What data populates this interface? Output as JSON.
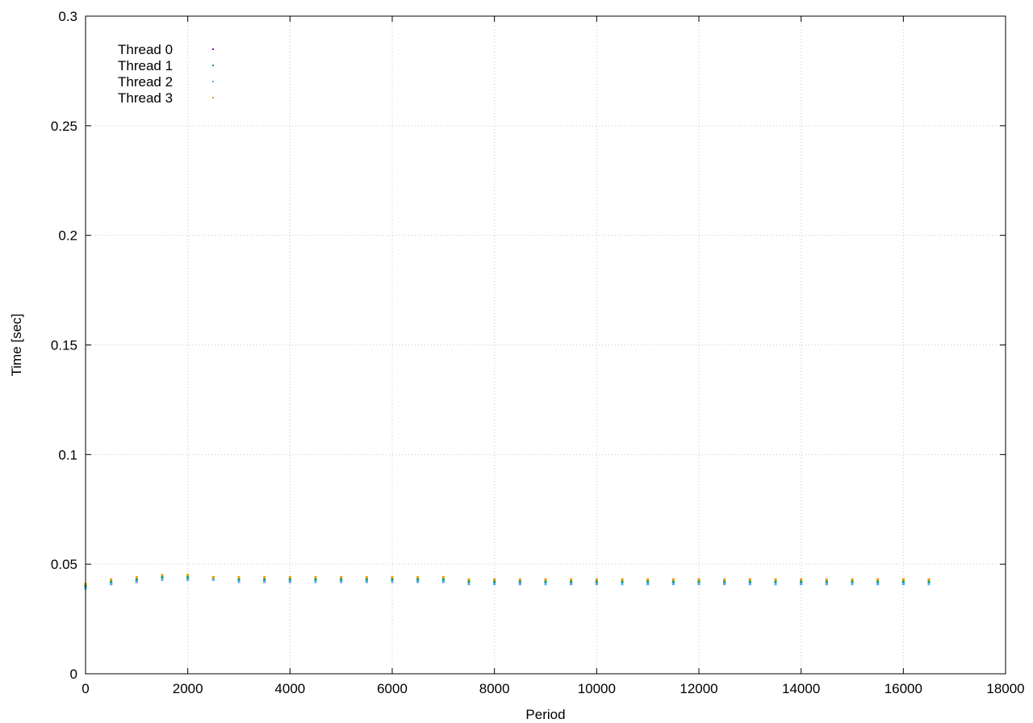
{
  "chart_data": {
    "type": "scatter",
    "title": "",
    "xlabel": "Period",
    "ylabel": "Time [sec]",
    "xlim": [
      0,
      18000
    ],
    "ylim": [
      0,
      0.3
    ],
    "xticks": [
      "0",
      "2000",
      "4000",
      "6000",
      "8000",
      "10000",
      "12000",
      "14000",
      "16000",
      "18000"
    ],
    "yticks": [
      "0",
      "0.05",
      "0.1",
      "0.15",
      "0.2",
      "0.25",
      "0.3"
    ],
    "grid": true,
    "legend_position": "top-left",
    "series": [
      {
        "name": "Thread 0",
        "color": "#9400d3",
        "x": [
          0,
          500,
          1000,
          1500,
          2000,
          2500,
          3000,
          3500,
          4000,
          4500,
          5000,
          5500,
          6000,
          6500,
          7000,
          7500,
          8000,
          8500,
          9000,
          9500,
          10000,
          10500,
          11000,
          11500,
          12000,
          12500,
          13000,
          13500,
          14000,
          14500,
          15000,
          15500,
          16000,
          16500
        ],
        "y": [
          0.039,
          0.041,
          0.042,
          0.043,
          0.043,
          0.043,
          0.042,
          0.042,
          0.042,
          0.042,
          0.042,
          0.042,
          0.042,
          0.042,
          0.042,
          0.041,
          0.041,
          0.041,
          0.041,
          0.041,
          0.041,
          0.041,
          0.041,
          0.041,
          0.041,
          0.041,
          0.041,
          0.041,
          0.041,
          0.041,
          0.041,
          0.041,
          0.041,
          0.041
        ]
      },
      {
        "name": "Thread 1",
        "color": "#009e73",
        "x": [
          0,
          500,
          1000,
          1500,
          2000,
          2500,
          3000,
          3500,
          4000,
          4500,
          5000,
          5500,
          6000,
          6500,
          7000,
          7500,
          8000,
          8500,
          9000,
          9500,
          10000,
          10500,
          11000,
          11500,
          12000,
          12500,
          13000,
          13500,
          14000,
          14500,
          15000,
          15500,
          16000,
          16500
        ],
        "y": [
          0.04,
          0.042,
          0.043,
          0.044,
          0.044,
          0.044,
          0.043,
          0.043,
          0.043,
          0.043,
          0.043,
          0.043,
          0.043,
          0.043,
          0.043,
          0.042,
          0.042,
          0.042,
          0.042,
          0.042,
          0.042,
          0.042,
          0.042,
          0.042,
          0.042,
          0.042,
          0.042,
          0.042,
          0.042,
          0.042,
          0.042,
          0.042,
          0.042,
          0.042
        ]
      },
      {
        "name": "Thread 2",
        "color": "#56b4e9",
        "x": [
          0,
          500,
          1000,
          1500,
          2000,
          2500,
          3000,
          3500,
          4000,
          4500,
          5000,
          5500,
          6000,
          6500,
          7000,
          7500,
          8000,
          8500,
          9000,
          9500,
          10000,
          10500,
          11000,
          11500,
          12000,
          12500,
          13000,
          13500,
          14000,
          14500,
          15000,
          15500,
          16000,
          16500
        ],
        "y": [
          0.039,
          0.041,
          0.042,
          0.043,
          0.043,
          0.043,
          0.042,
          0.042,
          0.042,
          0.042,
          0.042,
          0.042,
          0.042,
          0.042,
          0.042,
          0.041,
          0.041,
          0.041,
          0.041,
          0.041,
          0.041,
          0.041,
          0.041,
          0.041,
          0.041,
          0.041,
          0.041,
          0.041,
          0.041,
          0.041,
          0.041,
          0.041,
          0.041,
          0.041
        ]
      },
      {
        "name": "Thread 3",
        "color": "#e69f00",
        "x": [
          0,
          500,
          1000,
          1500,
          2000,
          2500,
          3000,
          3500,
          4000,
          4500,
          5000,
          5500,
          6000,
          6500,
          7000,
          7500,
          8000,
          8500,
          9000,
          9500,
          10000,
          10500,
          11000,
          11500,
          12000,
          12500,
          13000,
          13500,
          14000,
          14500,
          15000,
          15500,
          16000,
          16500
        ],
        "y": [
          0.041,
          0.043,
          0.044,
          0.045,
          0.045,
          0.044,
          0.044,
          0.044,
          0.044,
          0.044,
          0.044,
          0.044,
          0.044,
          0.044,
          0.044,
          0.043,
          0.043,
          0.043,
          0.043,
          0.043,
          0.043,
          0.043,
          0.043,
          0.043,
          0.043,
          0.043,
          0.043,
          0.043,
          0.043,
          0.043,
          0.043,
          0.043,
          0.043,
          0.043
        ]
      }
    ]
  }
}
